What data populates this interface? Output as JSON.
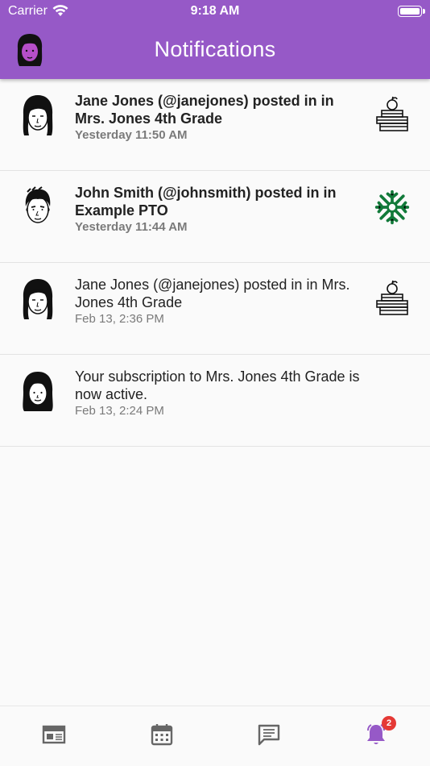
{
  "status_bar": {
    "carrier": "Carrier",
    "time": "9:18 AM"
  },
  "header": {
    "title": "Notifications"
  },
  "notifications": [
    {
      "message": "Jane Jones (@janejones) posted in in Mrs. Jones 4th Grade",
      "time": "Yesterday 11:50 AM",
      "unread": true,
      "avatar": "woman-short-hair-avatar",
      "group_icon": "books-apple-icon"
    },
    {
      "message": "John Smith (@johnsmith) posted in in Example PTO",
      "time": "Yesterday 11:44 AM",
      "unread": true,
      "avatar": "man-avatar",
      "group_icon": "snowflake-icon"
    },
    {
      "message": "Jane Jones (@janejones) posted in in Mrs. Jones 4th Grade",
      "time": "Feb 13, 2:36 PM",
      "unread": false,
      "avatar": "woman-short-hair-avatar",
      "group_icon": "books-apple-icon"
    },
    {
      "message": "Your subscription to Mrs. Jones 4th Grade is now active.",
      "time": "Feb 13, 2:24 PM",
      "unread": false,
      "avatar": "woman-long-hair-avatar",
      "group_icon": ""
    }
  ],
  "tabbar": {
    "items": [
      "feed-icon",
      "calendar-icon",
      "messages-icon",
      "notifications-bell-icon"
    ],
    "active": "notifications-bell-icon",
    "badge_count": "2"
  },
  "colors": {
    "header": "#9659c7",
    "active_tab": "#9659c7",
    "badge": "#e53935",
    "snowflake": "#127a3a"
  }
}
